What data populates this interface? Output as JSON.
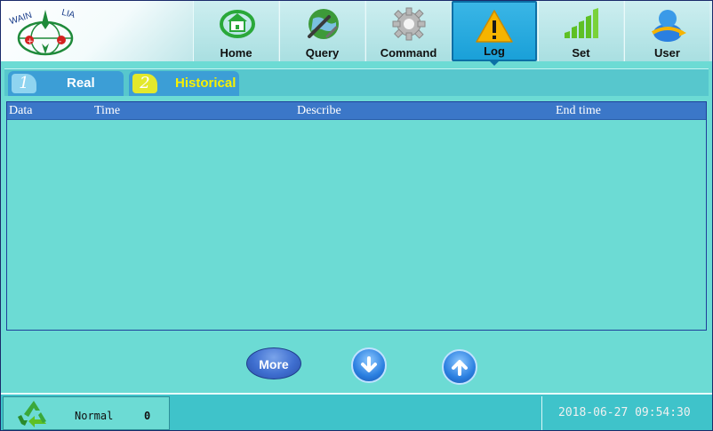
{
  "brand": {
    "logo_text": "WAIN LIA"
  },
  "nav": {
    "items": [
      {
        "label": "Home",
        "icon": "home-icon"
      },
      {
        "label": "Query",
        "icon": "globe-wrench-icon"
      },
      {
        "label": "Command",
        "icon": "gear-icon"
      },
      {
        "label": "Log",
        "icon": "warning-icon",
        "active": true
      },
      {
        "label": "Set",
        "icon": "bar-chart-icon"
      },
      {
        "label": "User",
        "icon": "user-icon"
      }
    ]
  },
  "tabs": [
    {
      "num": "1",
      "label": "Real"
    },
    {
      "num": "2",
      "label": "Historical",
      "active": true
    }
  ],
  "table": {
    "columns": [
      "Data",
      "Time",
      "Describe",
      "End time"
    ],
    "rows": []
  },
  "buttons": {
    "more_label": "More",
    "down_icon": "arrow-down-icon",
    "up_icon": "arrow-up-icon"
  },
  "status": {
    "icon": "recycle-icon",
    "text": "Normal",
    "count": "0",
    "datetime": "2018-06-27 09:54:30"
  },
  "colors": {
    "background": "#6cdbd4",
    "header_row": "#3b77c8",
    "active_nav": "#1aa0d8",
    "historical_tab_text": "#f8f000"
  }
}
